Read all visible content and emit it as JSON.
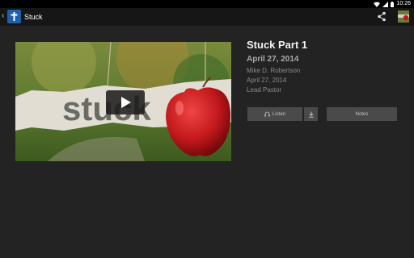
{
  "status_bar": {
    "time": "10:26"
  },
  "action_bar": {
    "back_icon": "chevron-left-icon",
    "title": "Stuck"
  },
  "video": {
    "thumbnail_text": "stuck"
  },
  "details": {
    "title": "Stuck Part 1",
    "date_heading": "April 27, 2014",
    "speaker": "Mike D. Robertson",
    "date": "April 27, 2014",
    "role": "Lead Pastor"
  },
  "buttons": {
    "listen_label": "Listen",
    "notes_label": "Notes"
  },
  "colors": {
    "background": "#232323",
    "button": "#4a4a4a",
    "apple_red": "#c0181b"
  }
}
